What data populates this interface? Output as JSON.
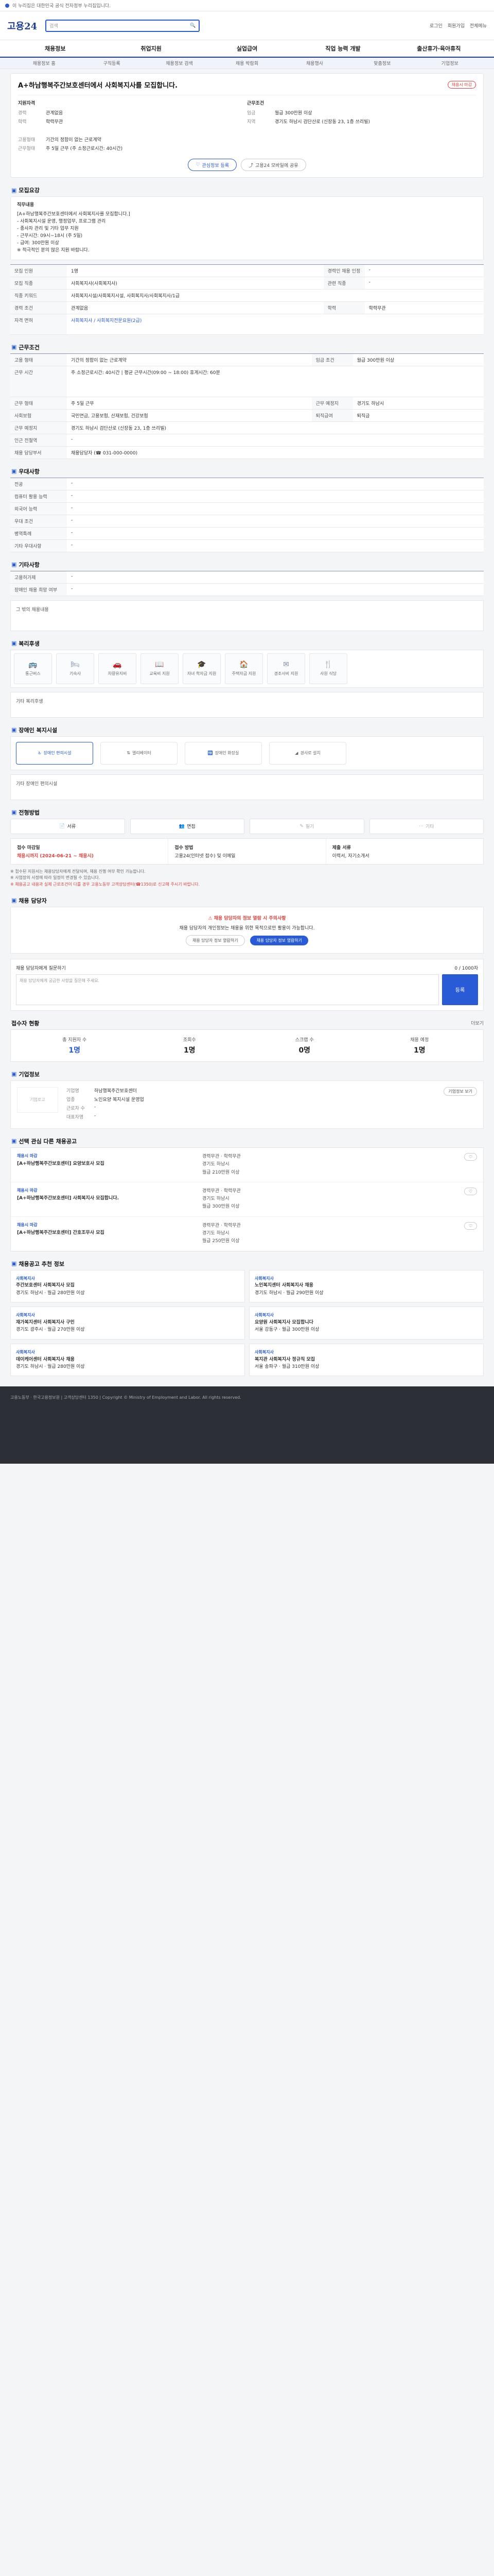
{
  "topbar": {
    "notice": "이 누리집은 대한민국 공식 전자정부 누리집입니다."
  },
  "header": {
    "logo": "고용24",
    "search_placeholder": "검색",
    "links": [
      "로그인",
      "회원가입",
      "전체메뉴"
    ]
  },
  "gnb": [
    "채용정보",
    "취업지원",
    "실업급여",
    "직업 능력 개발",
    "출산휴가·육아휴직"
  ],
  "subnav": [
    "채용정보 홈",
    "구직등록",
    "채용정보 검색",
    "채용 박람회",
    "채용행사",
    "맞춤정보",
    "기업정보"
  ],
  "job": {
    "title": "A+하남행복주간보호센터에서 사회복지사를 모집합니다.",
    "badge": "채용시 마감",
    "left_heading": "지원자격",
    "left": [
      {
        "k": "경력",
        "v": "관계없음"
      },
      {
        "k": "학력",
        "v": "학력무관"
      },
      {
        "k": "",
        "v": ""
      },
      {
        "k": "고용형태",
        "v": "기간의 정함이 없는 근로계약"
      },
      {
        "k": "근무형태",
        "v": "주 5일 근무 (주 소정근로시간: 40시간)"
      }
    ],
    "right_heading": "근무조건",
    "right": [
      {
        "k": "임금",
        "v": "월급 300만원 이상"
      },
      {
        "k": "지역",
        "v": "경기도 하남시 검단산로 (신장동 23, 1층 쓰리빌)"
      },
      {
        "k": "",
        "v": ""
      },
      {
        "k": "",
        "v": ""
      },
      {
        "k": "",
        "v": ""
      }
    ],
    "buttons": {
      "scrap": "관심정보 등록",
      "share": "고용24 모바일에 공유"
    }
  },
  "sections": {
    "recruit": "모집요강",
    "conditions": "근무조건",
    "preference": "우대사항",
    "other": "기타사항",
    "welfare": "복리후생",
    "barrier": "장애인 복지시설",
    "apply": "전형방법",
    "manager": "채용 담당자",
    "stats": "접수자 현황",
    "company": "기업정보",
    "others": "선택 관심 다른 채용공고",
    "recommend": "채용공고 추천 정보"
  },
  "recruit": {
    "desc_title": "직무내용",
    "desc": [
      "[A+하남행복주간보호센터에서 사회복지사를 모집합니다.]",
      "- 사회복지시설 운영, 행정업무, 프로그램 관리",
      "- 종사자 관리 및 기타 업무 지원",
      "- 근무시간: 09시~18시 (주 5일)",
      "- 급여: 300만원 이상",
      "※ 적극적인 분의 많은 지원 바랍니다."
    ],
    "rows": [
      {
        "k": "모집 인원",
        "v": "1명",
        "k2": "경력인 채용 인정",
        "v2": "-"
      },
      {
        "k": "모집 직종",
        "v": "사회복지사(사회복지사)",
        "k2": "관련 직종",
        "v2": "-"
      },
      {
        "k": "직종 키워드",
        "v": "사회복지시설/사회복지시설, 사회복지사/사회복지사/1급",
        "k2": "",
        "v2": ""
      },
      {
        "k": "경력 조건",
        "v": "관계없음",
        "k2": "학력",
        "v2": "학력무관"
      },
      {
        "k": "자격 면허",
        "v": "사회복지사 / 사회복지전문요원(2급)",
        "k2": "",
        "v2": ""
      }
    ]
  },
  "conditions": {
    "rows": [
      {
        "k": "고용 형태",
        "v": "기간의 정함이 없는 근로계약",
        "k2": "임금 조건",
        "v2": "월급 300만원 이상"
      },
      {
        "k": "근무 시간",
        "v": "주 소정근로시간: 40시간 | 평균 근무시간(09:00 ~ 18:00) 휴게시간: 60분",
        "k2": "",
        "v2": ""
      },
      {
        "k": "근무 형태",
        "v": "주 5일 근무",
        "k2": "근무 예정지",
        "v2": "경기도 하남시"
      },
      {
        "k": "사회보험",
        "v": "국민연금, 고용보험, 산재보험, 건강보험",
        "k2": "퇴직급여",
        "v2": "퇴직금"
      },
      {
        "k": "근무 예정지",
        "v": "경기도 하남시 검단산로 (신장동 23, 1층 쓰리빌)",
        "k2": "",
        "v2": ""
      },
      {
        "k": "인근 전철역",
        "v": "-",
        "k2": "",
        "v2": ""
      },
      {
        "k": "채용 담당부서",
        "v": "채용담당자 (☎ 031-000-0000)",
        "k2": "",
        "v2": ""
      }
    ]
  },
  "preference": {
    "rows": [
      {
        "k": "전공",
        "v": "-"
      },
      {
        "k": "컴퓨터 활용 능력",
        "v": "-"
      },
      {
        "k": "외국어 능력",
        "v": "-"
      },
      {
        "k": "우대 조건",
        "v": "-"
      },
      {
        "k": "병역특례",
        "v": "-"
      },
      {
        "k": "기타 우대사항",
        "v": "-"
      }
    ]
  },
  "other": {
    "rows": [
      {
        "k": "고용허가제",
        "v": "-"
      },
      {
        "k": "장애인 채용 희망 여부",
        "v": "-"
      }
    ],
    "note": "그 밖의 채용내용"
  },
  "welfare": {
    "items": [
      "통근버스",
      "기숙사",
      "차량유지비",
      "교육비 지원",
      "자녀 학자금 지원",
      "주택자금 지원",
      "경조사비 지원",
      "사원 식당"
    ],
    "note": "기타 복리후생"
  },
  "barrier": {
    "items": [
      "장애인 편의시설",
      "엘리베이터",
      "장애인 화장실",
      "경사로 설치"
    ],
    "note": "기타 장애인 편의시설"
  },
  "apply": {
    "methods": [
      "서류",
      "면접",
      "필기",
      "기타"
    ],
    "cols": [
      {
        "lbl": "접수 마감일",
        "v": "채용시까지 (2024-06-21 ~ 채용시)",
        "red": true
      },
      {
        "lbl": "접수 방법",
        "v": "고용24(인터넷 접수) 및 이메일"
      },
      {
        "lbl": "제출 서류",
        "v": "이력서, 자기소개서"
      }
    ],
    "notes": [
      "※ 접수된 지원서는 채용담당자에게 전달되며, 채용 진행 여부 확인 가능합니다.",
      "※ 사업장의 사정에 따라 일정이 변경될 수 있습니다.",
      "※ 채용공고 내용과 실제 근로조건이 다를 경우 고용노동부 고객상담센터(☎1350)로 신고해 주시기 바랍니다."
    ]
  },
  "manager": {
    "warn": "채용 담당자의 정보 열람 시 주의사항",
    "text": "채용 담당자의 개인정보는 채용을 위한 목적으로만 활용이 가능합니다.",
    "btn1": "채용 담당자 정보 열람하기",
    "btn2": "채용 담당자 정보 열람하기"
  },
  "inquiry": {
    "title": "채용 담당자에게 질문하기",
    "count": "0 / 1000자",
    "placeholder": "채용 담당자에게 궁금한 사항을 질문해 주세요.",
    "button": "등록"
  },
  "stats": {
    "more": "더보기",
    "items": [
      {
        "label": "총 지원자 수",
        "num": "1명",
        "blue": true
      },
      {
        "label": "조회수",
        "num": "1명",
        "blue": false
      },
      {
        "label": "스크랩 수",
        "num": "0명",
        "blue": false
      },
      {
        "label": "채용 예정",
        "num": "1명",
        "blue": false
      }
    ]
  },
  "company": {
    "logo": "기업로고",
    "rows": [
      {
        "k": "기업명",
        "v": "하남행복주간보호센터"
      },
      {
        "k": "업종",
        "v": "노인요양 복지시설 운영업"
      },
      {
        "k": "근로자 수",
        "v": "-"
      },
      {
        "k": "대표자명",
        "v": "-"
      }
    ],
    "btn": "기업정보 보기"
  },
  "others": [
    {
      "cat": "채용시 마감",
      "title": "[A+하남행복주간보호센터] 요양보호사 모집",
      "meta": [
        "경력무관 · 학력무관",
        "경기도 하남시",
        "월급 210만원 이상"
      ]
    },
    {
      "cat": "채용시 마감",
      "title": "[A+하남행복주간보호센터] 사회복지사 모집합니다.",
      "meta": [
        "경력무관 · 학력무관",
        "경기도 하남시",
        "월급 300만원 이상"
      ]
    },
    {
      "cat": "채용시 마감",
      "title": "[A+하남행복주간보호센터] 간호조무사 모집",
      "meta": [
        "경력무관 · 학력무관",
        "경기도 하남시",
        "월급 250만원 이상"
      ]
    }
  ],
  "recommend": [
    {
      "cat": "사회복지사",
      "title": "주간보호센터 사회복지사 모집",
      "meta": "경기도 하남시 · 월급 280만원 이상"
    },
    {
      "cat": "사회복지사",
      "title": "노인복지센터 사회복지사 채용",
      "meta": "경기도 하남시 · 월급 290만원 이상"
    },
    {
      "cat": "사회복지사",
      "title": "재가복지센터 사회복지사 구인",
      "meta": "경기도 광주시 · 월급 270만원 이상"
    },
    {
      "cat": "사회복지사",
      "title": "요양원 사회복지사 모집합니다",
      "meta": "서울 강동구 · 월급 300만원 이상"
    },
    {
      "cat": "사회복지사",
      "title": "데이케어센터 사회복지사 채용",
      "meta": "경기도 하남시 · 월급 280만원 이상"
    },
    {
      "cat": "사회복지사",
      "title": "복지관 사회복지사 정규직 모집",
      "meta": "서울 송파구 · 월급 310만원 이상"
    }
  ],
  "footer": {
    "text": "고용노동부 · 한국고용정보원 | 고객상담센터 1350 | Copyright © Ministry of Employment and Labor. All rights reserved."
  },
  "colors": {
    "accent": "#2a5bd7",
    "brand": "#1f3f8f",
    "alert": "#e0413c"
  }
}
